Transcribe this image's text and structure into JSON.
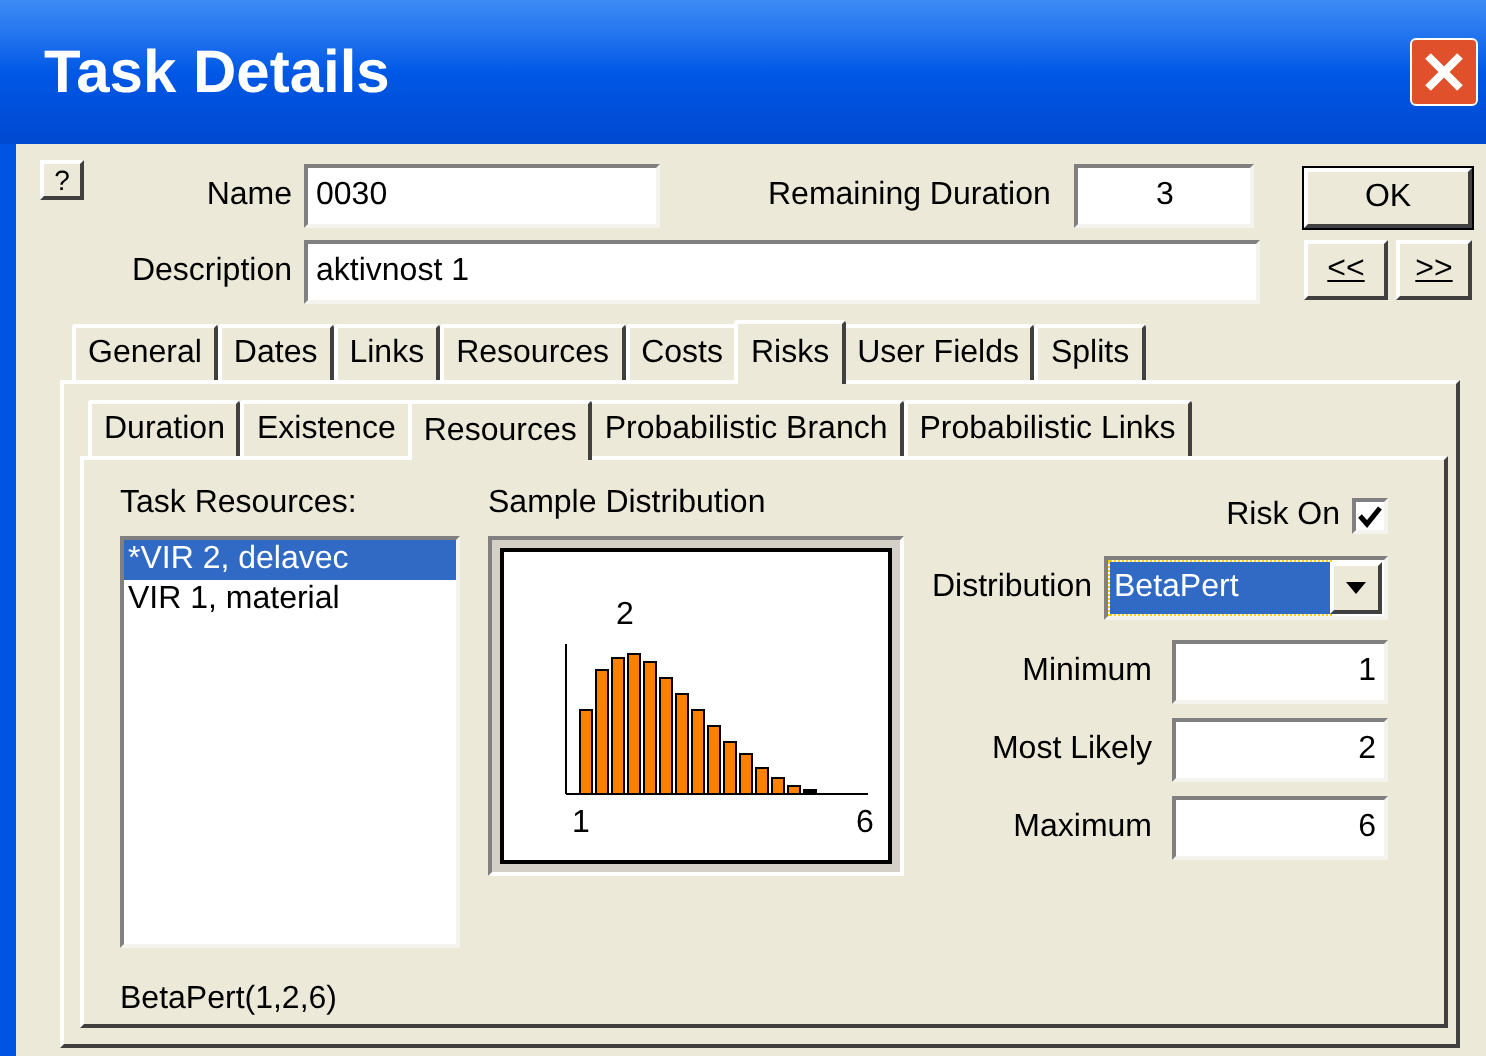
{
  "window": {
    "title": "Task Details"
  },
  "help_button": "?",
  "name": {
    "label": "Name",
    "value": "0030"
  },
  "remaining_duration": {
    "label": "Remaining Duration",
    "value": "3"
  },
  "description": {
    "label": "Description",
    "value": "aktivnost 1"
  },
  "buttons": {
    "ok": "OK",
    "prev": "<<",
    "next": ">>"
  },
  "tabs": [
    {
      "label": "General",
      "selected": false
    },
    {
      "label": "Dates",
      "selected": false
    },
    {
      "label": "Links",
      "selected": false
    },
    {
      "label": "Resources",
      "selected": false
    },
    {
      "label": "Costs",
      "selected": false
    },
    {
      "label": "Risks",
      "selected": true
    },
    {
      "label": "User Fields",
      "selected": false
    },
    {
      "label": "Splits",
      "selected": false
    }
  ],
  "subtabs": [
    {
      "label": "Duration",
      "selected": false
    },
    {
      "label": "Existence",
      "selected": false
    },
    {
      "label": "Resources",
      "selected": true
    },
    {
      "label": "Probabilistic Branch",
      "selected": false
    },
    {
      "label": "Probabilistic Links",
      "selected": false
    }
  ],
  "task_resources": {
    "label": "Task Resources:",
    "items": [
      {
        "label": "*VIR 2, delavec",
        "selected": true
      },
      {
        "label": "VIR 1, material",
        "selected": false
      }
    ],
    "formula": "BetaPert(1,2,6)"
  },
  "sample_distribution": {
    "label": "Sample Distribution",
    "peak_label": "2",
    "min_label": "1",
    "max_label": "6"
  },
  "risk_on": {
    "label": "Risk On",
    "checked": true
  },
  "distribution": {
    "label": "Distribution",
    "value": "BetaPert"
  },
  "fields": [
    {
      "label": "Minimum",
      "value": "1"
    },
    {
      "label": "Most Likely",
      "value": "2"
    },
    {
      "label": "Maximum",
      "value": "6"
    }
  ]
}
